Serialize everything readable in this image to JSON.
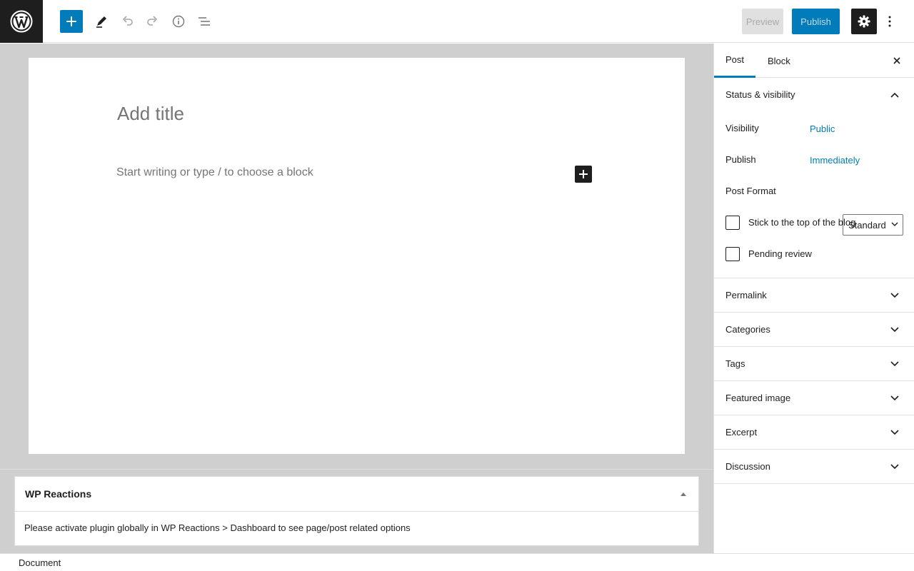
{
  "toolbar": {
    "preview_label": "Preview",
    "publish_label": "Publish"
  },
  "editor": {
    "title_placeholder": "Add title",
    "block_placeholder": "Start writing or type / to choose a block"
  },
  "metabox": {
    "title": "WP Reactions",
    "message": "Please activate plugin globally in WP Reactions > Dashboard to see page/post related options"
  },
  "footer": {
    "breadcrumb": "Document"
  },
  "sidebar": {
    "tabs": [
      {
        "label": "Post",
        "active": true
      },
      {
        "label": "Block",
        "active": false
      }
    ],
    "status_panel": {
      "title": "Status & visibility",
      "visibility_label": "Visibility",
      "visibility_value": "Public",
      "publish_label": "Publish",
      "publish_value": "Immediately",
      "format_label": "Post Format",
      "format_value": "Standard",
      "sticky_label": "Stick to the top of the blog",
      "sticky_checked": false,
      "pending_label": "Pending review",
      "pending_checked": false
    },
    "panels": [
      {
        "title": "Permalink"
      },
      {
        "title": "Categories"
      },
      {
        "title": "Tags"
      },
      {
        "title": "Featured image"
      },
      {
        "title": "Excerpt"
      },
      {
        "title": "Discussion"
      }
    ]
  },
  "colors": {
    "accent": "#007cba",
    "dark": "#1e1e1e",
    "editor_bg": "#cfcfcf"
  },
  "icons": [
    "wordpress-logo-icon",
    "plus-icon",
    "pencil-icon",
    "undo-icon",
    "redo-icon",
    "info-icon",
    "list-view-icon",
    "gear-icon",
    "more-vertical-icon",
    "close-icon",
    "chevron-up-icon",
    "chevron-down-icon",
    "triangle-up-icon"
  ]
}
